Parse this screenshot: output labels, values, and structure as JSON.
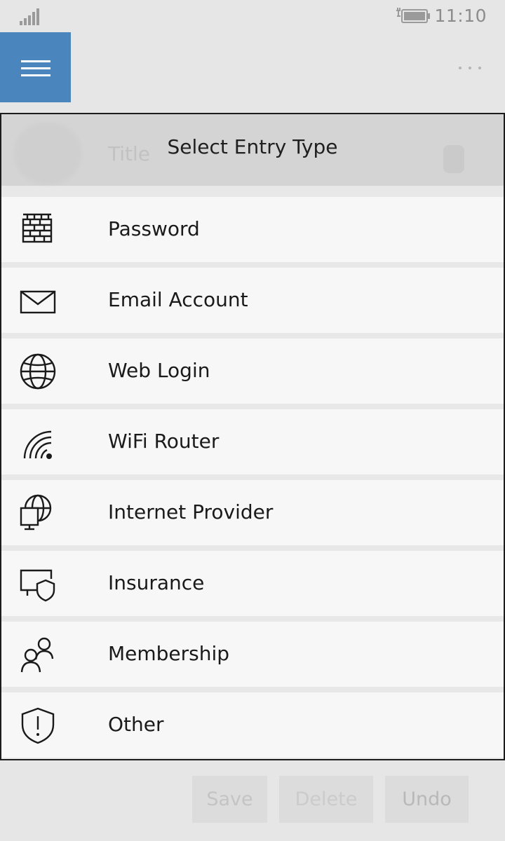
{
  "status_bar": {
    "time": "11:10",
    "signal_icon": "signal-bars-icon",
    "battery_icon": "battery-charging-icon"
  },
  "app_bar": {
    "menu_icon": "hamburger-icon",
    "more_icon": "more-dots-icon",
    "accent_color": "#4a85bd"
  },
  "background_form": {
    "title_placeholder": "Title"
  },
  "dialog": {
    "title": "Select Entry Type",
    "items": [
      {
        "label": "Password",
        "icon": "brick-wall-icon"
      },
      {
        "label": "Email Account",
        "icon": "envelope-icon"
      },
      {
        "label": "Web Login",
        "icon": "globe-icon"
      },
      {
        "label": "WiFi Router",
        "icon": "wifi-icon"
      },
      {
        "label": "Internet Provider",
        "icon": "globe-monitor-icon"
      },
      {
        "label": "Insurance",
        "icon": "shield-screen-icon"
      },
      {
        "label": "Membership",
        "icon": "people-icon"
      },
      {
        "label": "Other",
        "icon": "shield-exclamation-icon"
      }
    ]
  },
  "bottom_bar": {
    "save_label": "Save",
    "delete_label": "Delete",
    "undo_label": "Undo"
  }
}
